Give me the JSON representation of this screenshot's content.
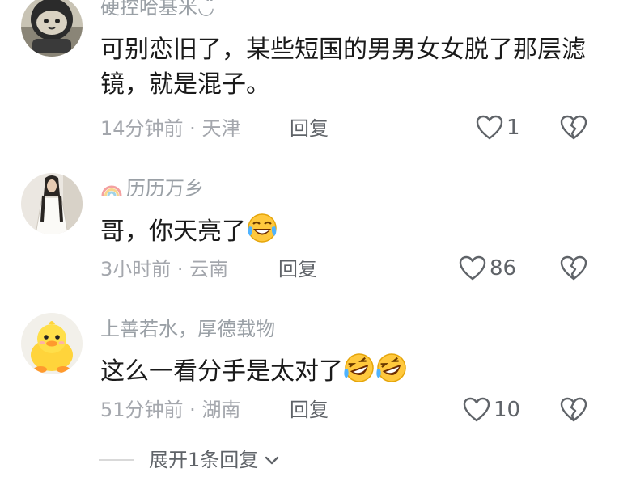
{
  "comments": [
    {
      "username": "硬控哈基米",
      "username_suffix": "◡̈",
      "text": "可别恋旧了，某些短国的男男女女脱了那层滤镜，就是混子。",
      "time": "14分钟前",
      "location": "天津",
      "reply_label": "回复",
      "likes": "1",
      "avatar_icon": "astronaut-cat-avatar"
    },
    {
      "username": "历历万乡",
      "text": "哥，你天亮了",
      "time": "3小时前",
      "location": "云南",
      "reply_label": "回复",
      "likes": "86",
      "avatar_icon": "girl-white-dress-avatar",
      "badge_icon": "rainbow-icon"
    },
    {
      "username": "上善若水，厚德载物",
      "text": "这么一看分手是太对了",
      "time": "51分钟前",
      "location": "湖南",
      "reply_label": "回复",
      "likes": "10",
      "avatar_icon": "yellow-duck-avatar"
    }
  ],
  "expand_replies_label": "展开1条回复",
  "separator": " · ",
  "colors": {
    "meta_gray": "#a4a7ad",
    "text_dark": "#1a1a1a",
    "icon_gray": "#5f6368"
  }
}
